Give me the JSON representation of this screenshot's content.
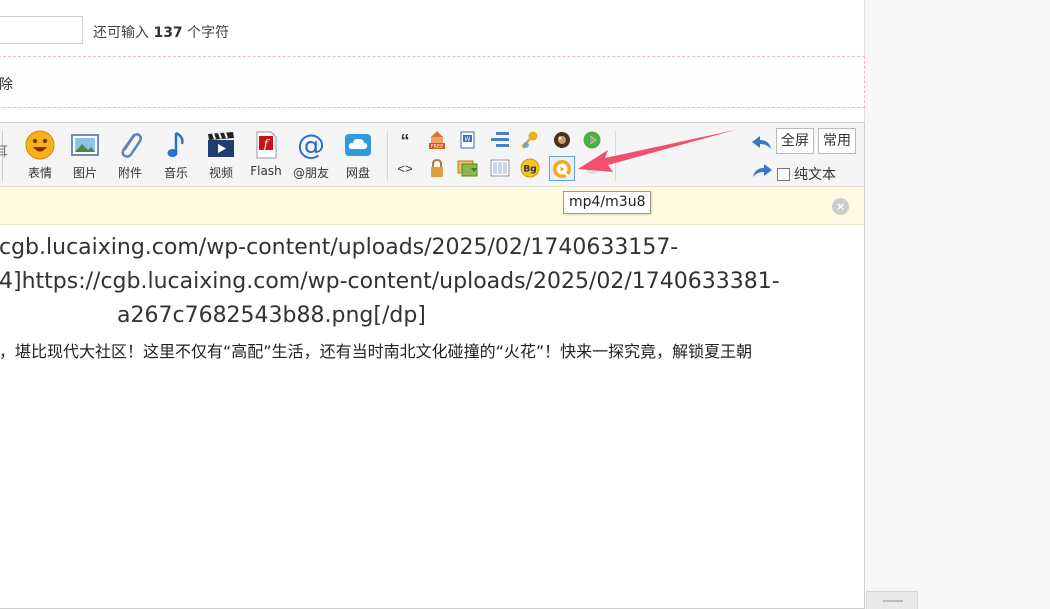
{
  "title_field": {
    "remaining_prefix": "还可输入",
    "remaining_count": "137",
    "remaining_suffix": "个字符"
  },
  "notice": {
    "text": "除"
  },
  "toolbar": {
    "left_stub": "耳",
    "buttons": [
      {
        "label": "表情",
        "icon": "smiley-icon"
      },
      {
        "label": "图片",
        "icon": "image-icon"
      },
      {
        "label": "附件",
        "icon": "paperclip-icon"
      },
      {
        "label": "音乐",
        "icon": "music-note-icon"
      },
      {
        "label": "视频",
        "icon": "film-icon"
      },
      {
        "label": "Flash",
        "icon": "flash-icon"
      },
      {
        "label": "@朋友",
        "icon": "at-icon"
      },
      {
        "label": "网盘",
        "icon": "cloud-icon"
      }
    ],
    "small_tools": {
      "quote": "“",
      "code": "<>",
      "free": "FREE",
      "bg": "Bg"
    },
    "fullscreen_label": "全屏",
    "common_label": "常用",
    "plain_text_label": "纯文本",
    "tooltip": "mp4/m3u8"
  },
  "editor_content": {
    "line1": "cgb.lucaixing.com/wp-content/uploads/2025/02/1740633157-",
    "line2": "4]https://cgb.lucaixing.com/wp-content/uploads/2025/02/1740633381-",
    "line3": "a267c7682543b88.png[/dp]",
    "line4": "，堪比现代大社区！这里不仅有“高配”生活，还有当时南北文化碰撞的“火花”！快来一探究竟，解锁夏王朝"
  },
  "colors": {
    "arrow": "#f0506e",
    "tooltip_border": "#999999",
    "hint_bar": "#fffbe2"
  }
}
